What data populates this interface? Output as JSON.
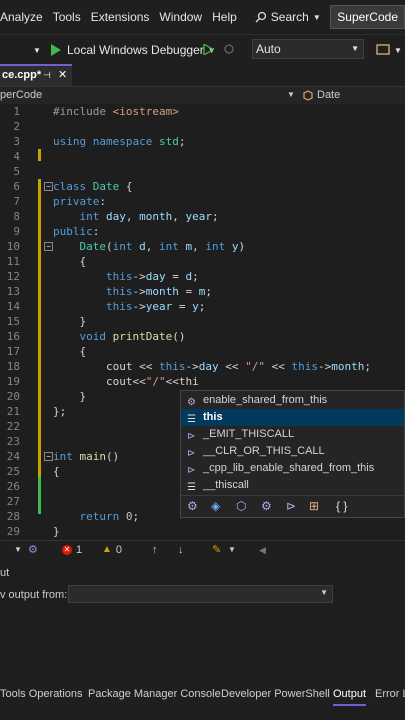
{
  "menu": {
    "items": [
      "Analyze",
      "Tools",
      "Extensions",
      "Window",
      "Help"
    ],
    "search_label": "Search",
    "solution_name": "SuperCode"
  },
  "toolbar": {
    "debugger_label": "Local Windows Debugger",
    "config_value": "Auto"
  },
  "tabs": {
    "file_tab": "ce.cpp*"
  },
  "navbar": {
    "project": "perCode",
    "scope": "Date"
  },
  "editor": {
    "line_numbers": [
      "1",
      "2",
      "3",
      "4",
      "5",
      "6",
      "7",
      "8",
      "9",
      "10",
      "11",
      "12",
      "13",
      "14",
      "15",
      "16",
      "17",
      "18",
      "19",
      "20",
      "21",
      "22",
      "23",
      "24",
      "25",
      "26",
      "27",
      "28",
      "29"
    ],
    "lines": [
      "#include <iostream>",
      "",
      "using namespace std;",
      "",
      "",
      "class Date {",
      "private:",
      "    int day, month, year;",
      "public:",
      "    Date(int d, int m, int y)",
      "    {",
      "        this->day = d;",
      "        this->month = m;",
      "        this->year = y;",
      "    }",
      "    void printDate()",
      "    {",
      "        cout << this->day << \"/\" << this->month;",
      "        cout<<\"/\"<<thi",
      "    }",
      "};",
      "",
      "",
      "int main()",
      "{",
      "",
      "",
      "    return 0;",
      "}"
    ]
  },
  "autocomplete": {
    "items": [
      {
        "label": "enable_shared_from_this",
        "icon": "template-icon"
      },
      {
        "label": "this",
        "icon": "keyword-icon"
      },
      {
        "label": "_EMIT_THISCALL",
        "icon": "macro-icon"
      },
      {
        "label": "__CLR_OR_THIS_CALL",
        "icon": "macro-icon"
      },
      {
        "label": "_cpp_lib_enable_shared_from_this",
        "icon": "macro-icon"
      },
      {
        "label": "__thiscall",
        "icon": "keyword-icon"
      }
    ]
  },
  "status": {
    "errors": "1",
    "warnings": "0"
  },
  "output": {
    "title": "ut",
    "show_from_label": "v output from:"
  },
  "bottom_tabs": [
    "Tools Operations",
    "Package Manager Console",
    "Developer PowerShell",
    "Output",
    "Error L"
  ]
}
